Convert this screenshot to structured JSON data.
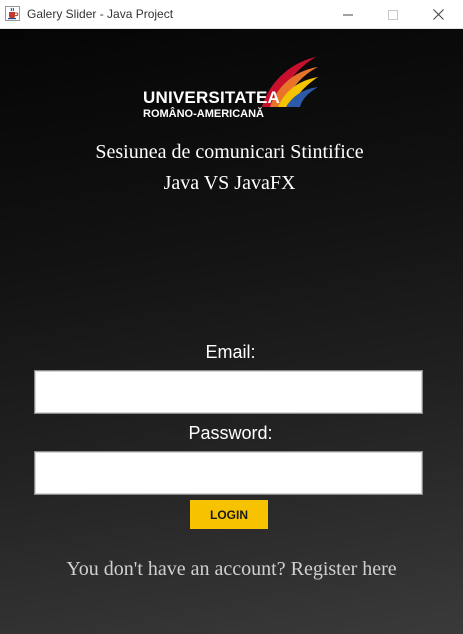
{
  "window": {
    "title": "Galery Slider - Java Project"
  },
  "logo": {
    "line1": "UNIVERSITATEA",
    "line2": "ROMÂNO-AMERICANĂ"
  },
  "header": {
    "line1": "Sesiunea de comunicari Stintifice",
    "line2": "Java VS JavaFX"
  },
  "form": {
    "email_label": "Email:",
    "email_value": "",
    "password_label": "Password:",
    "password_value": "",
    "login_label": "LOGIN"
  },
  "footer": {
    "register_text": "You don't have an account? Register here"
  },
  "colors": {
    "accent": "#f7c200",
    "background_dark": "#0a0a0a",
    "background_light": "#3a3a3a"
  },
  "icons": {
    "app": "java-cup-icon",
    "minimize": "minimize-icon",
    "maximize": "maximize-icon",
    "close": "close-icon",
    "logo_mark": "university-swoosh-logo"
  }
}
